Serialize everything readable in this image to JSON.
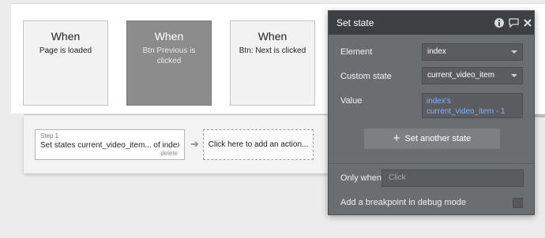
{
  "events": [
    {
      "when": "When",
      "description": "Page is loaded"
    },
    {
      "when": "When",
      "description": "Btn Previous is clicked"
    },
    {
      "when": "When",
      "description": "Btn: Next is clicked"
    }
  ],
  "workflow": {
    "step_label": "Step 1",
    "step_title": "Set states current_video_item... of index",
    "delete_label": "delete",
    "add_action_label": "Click here to add an action..."
  },
  "panel": {
    "title": "Set state",
    "element_label": "Element",
    "element_value": "index",
    "custom_state_label": "Custom state",
    "custom_state_value": "current_video_item",
    "value_label": "Value",
    "value_expression": "index's current_video_item - 1",
    "add_state_label": "Set another state",
    "only_when_label": "Only when",
    "only_when_placeholder": "Click",
    "breakpoint_label": "Add a breakpoint in debug mode"
  },
  "icons": {
    "info": "info-icon",
    "comment": "chat-icon",
    "close": "close-icon",
    "add": "plus-icon",
    "arrow": "arrow-right-icon"
  },
  "colors": {
    "panel_bg": "#6b6e71",
    "panel_header": "#3d4043",
    "link_value": "#7fb3ff",
    "selected_card": "#8c8c8c"
  }
}
